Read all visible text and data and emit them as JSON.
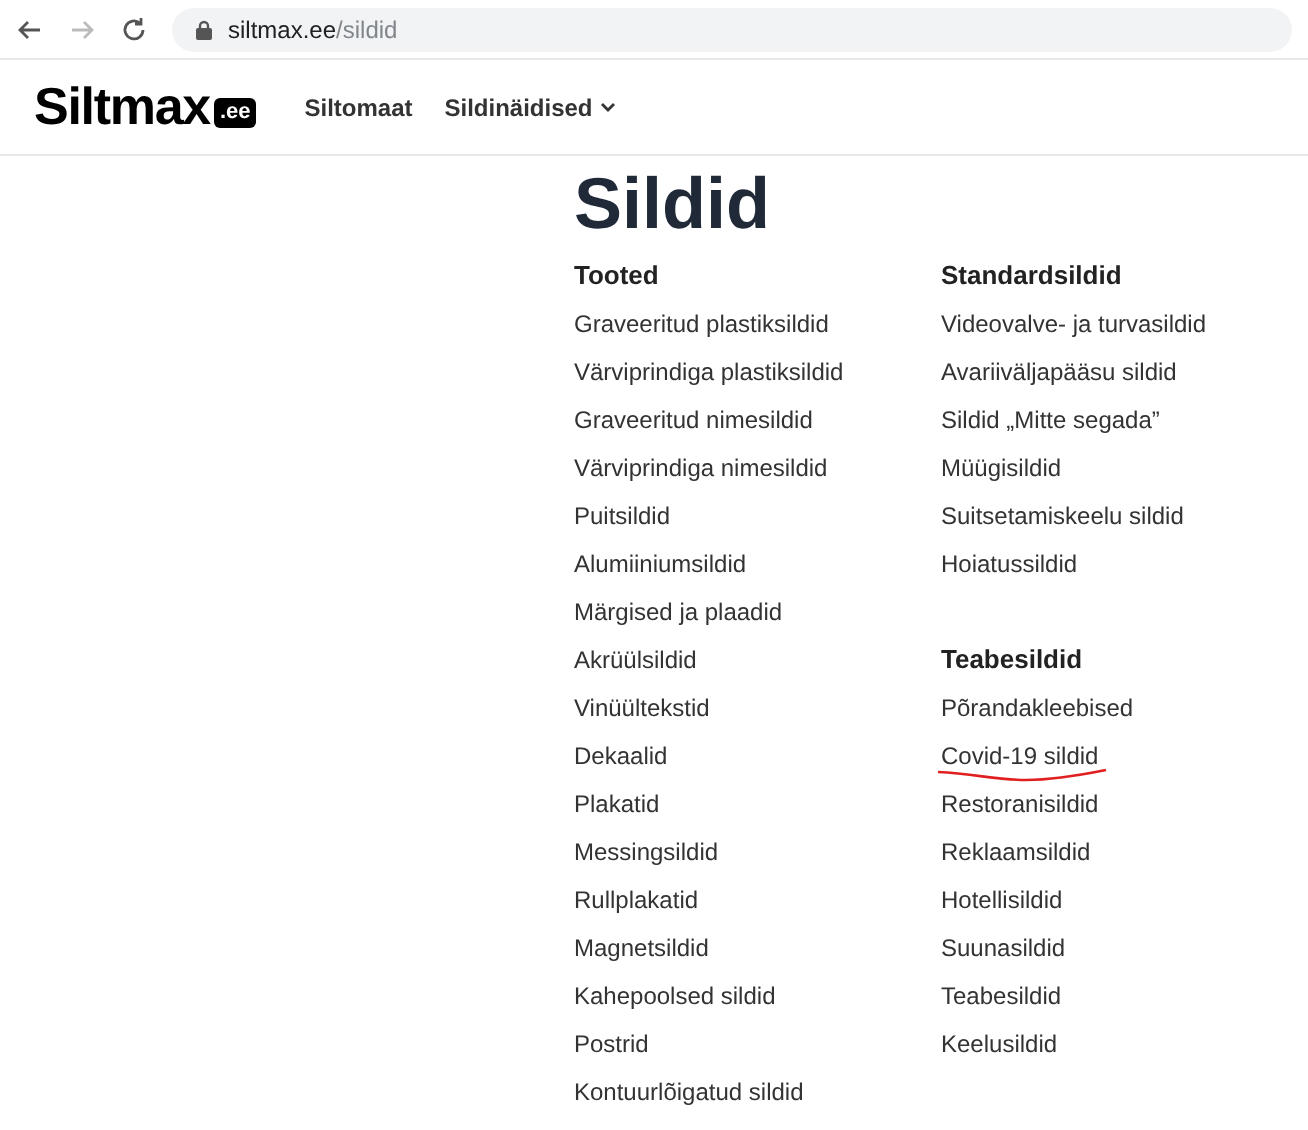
{
  "browser": {
    "url_host": "siltmax.ee",
    "url_path": "/sildid",
    "back_disabled": false,
    "forward_disabled": true
  },
  "header": {
    "logo": "Siltmax",
    "logo_badge": ".ee",
    "nav": [
      {
        "label": "Siltomaat",
        "dropdown": false
      },
      {
        "label": "Sildinäidised",
        "dropdown": true
      }
    ]
  },
  "title": "Sildid",
  "columns": [
    {
      "groups": [
        {
          "heading": "Tooted",
          "items": [
            {
              "label": "Graveeritud plastiksildid",
              "annotated": false
            },
            {
              "label": "Värviprindiga plastiksildid",
              "annotated": false
            },
            {
              "label": "Graveeritud nimesildid",
              "annotated": false
            },
            {
              "label": "Värviprindiga nimesildid",
              "annotated": false
            },
            {
              "label": "Puitsildid",
              "annotated": false
            },
            {
              "label": "Alumiiniumsildid",
              "annotated": false
            },
            {
              "label": "Märgised ja plaadid",
              "annotated": false
            },
            {
              "label": "Akrüülsildid",
              "annotated": false
            },
            {
              "label": "Vinüültekstid",
              "annotated": false
            },
            {
              "label": "Dekaalid",
              "annotated": false
            },
            {
              "label": "Plakatid",
              "annotated": false
            },
            {
              "label": "Messingsildid",
              "annotated": false
            },
            {
              "label": "Rullplakatid",
              "annotated": false
            },
            {
              "label": "Magnetsildid",
              "annotated": false
            },
            {
              "label": "Kahepoolsed sildid",
              "annotated": false
            },
            {
              "label": "Postrid",
              "annotated": false
            },
            {
              "label": "Kontuurlõigatud sildid",
              "annotated": false
            }
          ]
        }
      ]
    },
    {
      "groups": [
        {
          "heading": "Standardsildid",
          "items": [
            {
              "label": "Videovalve- ja turvasildid",
              "annotated": false
            },
            {
              "label": "Avariiväljapääsu sildid",
              "annotated": false
            },
            {
              "label": "Sildid „Mitte segada”",
              "annotated": false
            },
            {
              "label": "Müügisildid",
              "annotated": false
            },
            {
              "label": "Suitsetamiskeelu sildid",
              "annotated": false
            },
            {
              "label": "Hoiatussildid",
              "annotated": false
            }
          ]
        },
        {
          "heading": "Teabesildid",
          "items": [
            {
              "label": "Põrandakleebised",
              "annotated": false
            },
            {
              "label": "Covid-19 sildid",
              "annotated": true
            },
            {
              "label": "Restoranisildid",
              "annotated": false
            },
            {
              "label": "Reklaamsildid",
              "annotated": false
            },
            {
              "label": "Hotellisildid",
              "annotated": false
            },
            {
              "label": "Suunasildid",
              "annotated": false
            },
            {
              "label": "Teabesildid",
              "annotated": false
            },
            {
              "label": "Keelusildid",
              "annotated": false
            }
          ]
        }
      ]
    }
  ]
}
